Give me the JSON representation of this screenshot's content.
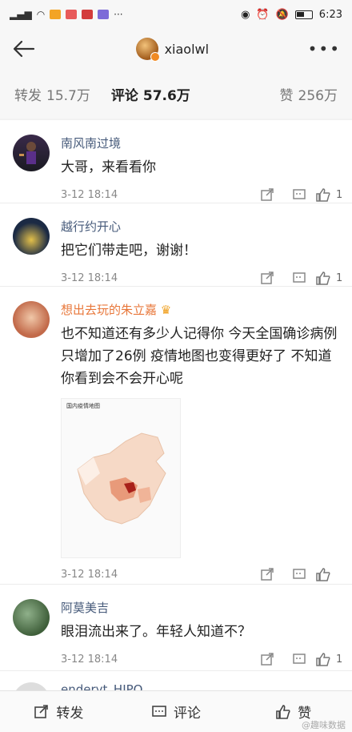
{
  "status_bar": {
    "time": "6:23"
  },
  "header": {
    "username": "xiaolwl"
  },
  "tabs": [
    {
      "label": "转发",
      "count": "15.7万"
    },
    {
      "label": "评论",
      "count": "57.6万"
    },
    {
      "label": "赞",
      "count": "256万"
    }
  ],
  "comments": [
    {
      "name": "南风南过境",
      "text": "大哥，来看看你",
      "time": "3-12 18:14",
      "likes": "1"
    },
    {
      "name": "越行约开心",
      "text": "把它们带走吧，谢谢！",
      "time": "3-12 18:14",
      "likes": "1"
    },
    {
      "name": "想出去玩的朱立嘉",
      "text": "也不知道还有多少人记得你 今天全国确诊病例只增加了26例 疫情地图也变得更好了 不知道你看到会不会开心呢",
      "time": "3-12 18:14",
      "likes": "",
      "image_title": "国内疫情地图"
    },
    {
      "name": "阿莫美吉",
      "text": "眼泪流出来了。年轻人知道不？",
      "time": "3-12 18:14",
      "likes": "1"
    },
    {
      "name": "enderyt_HIPO"
    }
  ],
  "bottom_bar": {
    "repost": "转发",
    "comment": "评论",
    "like": "赞"
  },
  "watermark": "@趣味数据",
  "colors": {
    "accent_orange": "#e8773a",
    "link_blue": "#465a7a"
  }
}
